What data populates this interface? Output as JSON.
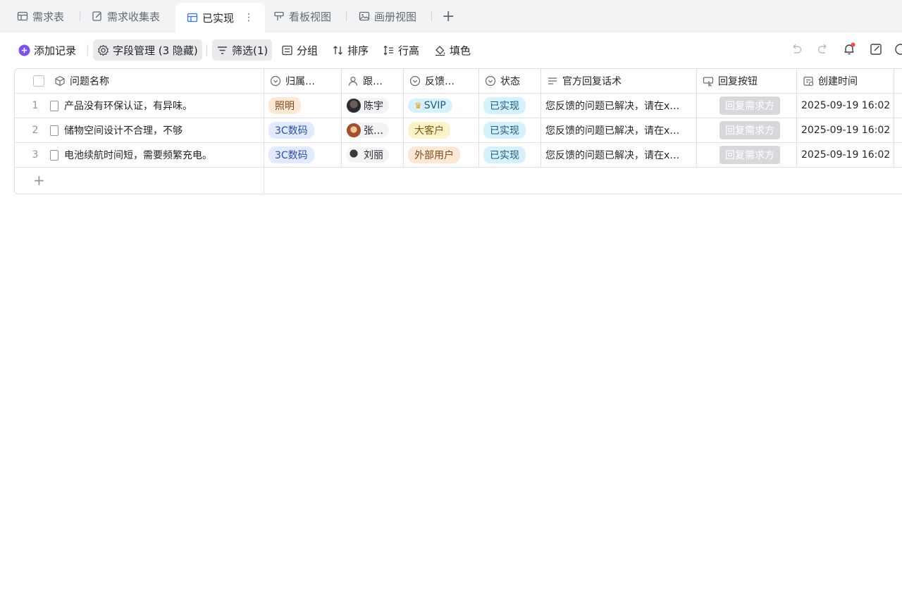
{
  "tabs": [
    {
      "label": "需求表",
      "icon": "table-icon"
    },
    {
      "label": "需求收集表",
      "icon": "form-icon"
    },
    {
      "label": "已实现",
      "icon": "table-icon",
      "active": true
    },
    {
      "label": "看板视图",
      "icon": "kanban-icon"
    },
    {
      "label": "画册视图",
      "icon": "gallery-icon"
    }
  ],
  "toolbar": {
    "add_record": "添加记录",
    "field_manage": "字段管理 (3 隐藏)",
    "filter": "筛选(1)",
    "group": "分组",
    "sort": "排序",
    "row_height": "行高",
    "fill_color": "填色"
  },
  "columns": [
    "问题名称",
    "归属…",
    "跟…",
    "反馈…",
    "状态",
    "官方回复话术",
    "回复按钮",
    "创建时间"
  ],
  "rows": [
    {
      "num": "1",
      "name": "产品没有环保认证，有异味。",
      "category": "照明",
      "owner": "陈宇",
      "feedback": "SVIP",
      "status": "已实现",
      "reply": "您反馈的问题已解决，请在x…",
      "button": "回复需求方",
      "created": "2025-09-19 16:02"
    },
    {
      "num": "2",
      "name": "储物空间设计不合理，不够",
      "category": "3C数码",
      "owner": "张…",
      "feedback": "大客户",
      "status": "已实现",
      "reply": "您反馈的问题已解决，请在x…",
      "button": "回复需求方",
      "created": "2025-09-19 16:02"
    },
    {
      "num": "3",
      "name": "电池续航时间短，需要频繁充电。",
      "category": "3C数码",
      "owner": "刘丽",
      "feedback": "外部用户",
      "status": "已实现",
      "reply": "您反馈的问题已解决，请在x…",
      "button": "回复需求方",
      "created": "2025-09-19 16:02"
    }
  ],
  "colors": {
    "accent": "#3370ff",
    "add_icon": "#7b4ff5",
    "tag_lighting_bg": "#fde9d3",
    "tag_3c_bg": "#e1eaff",
    "tag_svip_bg": "#d5f1fc",
    "tag_bigcustomer_bg": "#fdf3c8",
    "tag_external_bg": "#fde9d3",
    "status_bg": "#d5f1fc",
    "notify_dot": "#f54a45"
  }
}
